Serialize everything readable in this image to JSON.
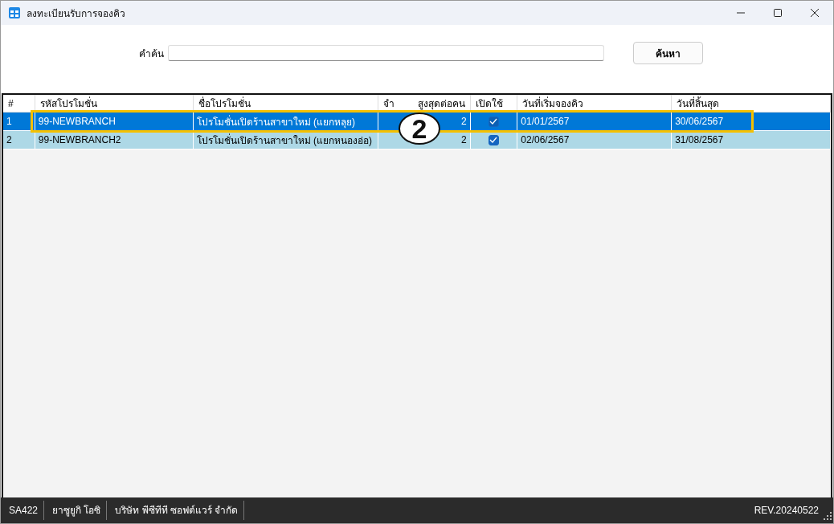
{
  "window": {
    "title": "ลงทะเบียนรับการจองคิว"
  },
  "search": {
    "label": "คำค้น",
    "button": "ค้นหา"
  },
  "table": {
    "columns": [
      {
        "label": "#"
      },
      {
        "label": "รหัสโปรโมชั่น"
      },
      {
        "label": "ชื่อโปรโมชั่น"
      },
      {
        "label": "จำ",
        "label_end": "สูงสุดต่อคน"
      },
      {
        "label": "เปิดใช้"
      },
      {
        "label": "วันที่เริ่มจองคิว"
      },
      {
        "label": "วันที่สิ้นสุด"
      }
    ],
    "rows": [
      {
        "selected": true,
        "index": "1",
        "code": "99-NEWBRANCH",
        "name": "โปรโมชั่นเปิดร้านสาขาใหม่ (แยกหลุย)",
        "count": "2",
        "enabled": true,
        "start": "01/01/2567",
        "end": "30/06/2567"
      },
      {
        "selected": false,
        "index": "2",
        "code": "99-NEWBRANCH2",
        "name": "โปรโมชั่นเปิดร้านสาขาใหม่ (แยกหนองอ่อ)",
        "count": "2",
        "enabled": true,
        "start": "02/06/2567",
        "end": "31/08/2567"
      }
    ]
  },
  "annotation": {
    "label": "2"
  },
  "status_bar": {
    "items": [
      "SA422",
      "ยาซูยูกิ  โอซิ",
      "บริษัท พีซีทีที ซอฟต์แวร์ จำกัด"
    ],
    "version": "REV.20240522"
  }
}
